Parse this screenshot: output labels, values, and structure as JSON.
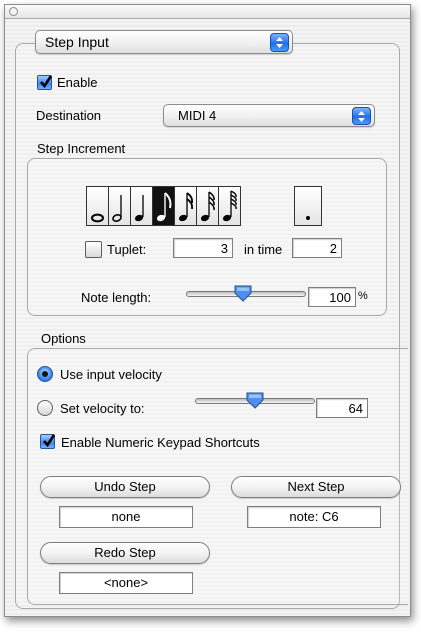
{
  "header": {
    "mode_value": "Step Input"
  },
  "enable": {
    "label": "Enable",
    "checked": true
  },
  "destination": {
    "label": "Destination",
    "value": "MIDI 4"
  },
  "step_increment": {
    "title": "Step Increment",
    "note_icons": [
      "whole-note-icon",
      "half-note-icon",
      "quarter-note-icon",
      "eighth-note-icon",
      "sixteenth-note-icon",
      "thirty-second-note-icon",
      "sixty-fourth-note-icon"
    ],
    "selected_note": "eighth-note-icon",
    "dotted_icon": "dot-icon",
    "tuplet_label": "Tuplet:",
    "tuplet_checked": false,
    "tuplet_value": "3",
    "in_time_label": "in time",
    "in_time_value": "2",
    "note_length_label": "Note length:",
    "note_length_value": "100",
    "note_length_unit": "%",
    "note_length_level": 0.55
  },
  "options": {
    "title": "Options",
    "use_input_velocity_label": "Use input velocity",
    "use_input_velocity_selected": true,
    "set_velocity_label": "Set velocity to:",
    "velocity_value": "64",
    "velocity_level": 0.5,
    "numeric_keypad_label": "Enable Numeric Keypad Shortcuts",
    "numeric_keypad_checked": true
  },
  "actions": {
    "undo_label": "Undo Step",
    "undo_value": "none",
    "next_label": "Next Step",
    "next_value": "note: C6",
    "redo_label": "Redo Step",
    "redo_value": "<none>"
  },
  "colors": {
    "accent_blue": "#3b86f0"
  }
}
